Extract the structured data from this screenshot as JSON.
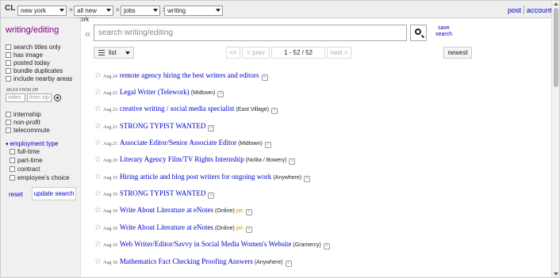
{
  "topbar": {
    "logo": "CL",
    "area": "new york",
    "subarea": "all new york",
    "category": "jobs",
    "subcategory": "writing",
    "gt": ">",
    "post_label": "post",
    "account_label": "account"
  },
  "sidebar": {
    "category_title": "writing/editing",
    "options": [
      "search titles only",
      "has image",
      "posted today",
      "bundle duplicates",
      "include nearby areas"
    ],
    "miles_label": "MILES FROM ZIP",
    "miles_placeholder": "miles",
    "zip_placeholder": "from zip",
    "job_flags": [
      "internship",
      "non-profit",
      "telecommute"
    ],
    "employment_type_label": "employment type",
    "employment_types": [
      "full-time",
      "part-time",
      "contract",
      "employee's choice"
    ],
    "reset_label": "reset",
    "update_label": "update search"
  },
  "search": {
    "placeholder": "search writing/editing",
    "save_line1": "save",
    "save_line2": "search"
  },
  "toolbar": {
    "view_label": "list",
    "first_label": "<<",
    "prev_label": "< prev",
    "page_info": "1 - 52 / 52",
    "next_label": "next >",
    "sort_label": "newest"
  },
  "listings": [
    {
      "date": "Aug 24",
      "title": "remote agency hiring the best writers and editors",
      "hood": "",
      "pic": ""
    },
    {
      "date": "Aug 23",
      "title": "Legal Writer (Telework)",
      "hood": "(Midtown)",
      "pic": ""
    },
    {
      "date": "Aug 23",
      "title": "creative writing / social media specialist",
      "hood": "(East Village)",
      "pic": ""
    },
    {
      "date": "Aug 21",
      "title": "STRONG TYPIST WANTED",
      "hood": "",
      "pic": ""
    },
    {
      "date": "Aug 21",
      "title": "Associate Editor/Senior Associate Editor",
      "hood": "(Midtown)",
      "pic": ""
    },
    {
      "date": "Aug 20",
      "title": "Literary Agency Film/TV Rights Internship",
      "hood": "(Nolita / Bowery)",
      "pic": ""
    },
    {
      "date": "Aug 19",
      "title": "Hiring article and blog post writers for ongoing work",
      "hood": "(Anywhere)",
      "pic": ""
    },
    {
      "date": "Aug 19",
      "title": "STRONG TYPIST WANTED",
      "hood": "",
      "pic": ""
    },
    {
      "date": "Aug 19",
      "title": "Write About Literature at eNotes",
      "hood": "(Online)",
      "pic": "pic"
    },
    {
      "date": "Aug 19",
      "title": "Write About Literature at eNotes",
      "hood": "(Online)",
      "pic": "pic"
    },
    {
      "date": "Aug 19",
      "title": "Web Writer/Editor/Savvy in Social Media Women's Website",
      "hood": "(Gramercy)",
      "pic": ""
    },
    {
      "date": "Aug 18",
      "title": "Mathematics Fact Checking Proofing Answers",
      "hood": "(Anywhere)",
      "pic": ""
    }
  ]
}
